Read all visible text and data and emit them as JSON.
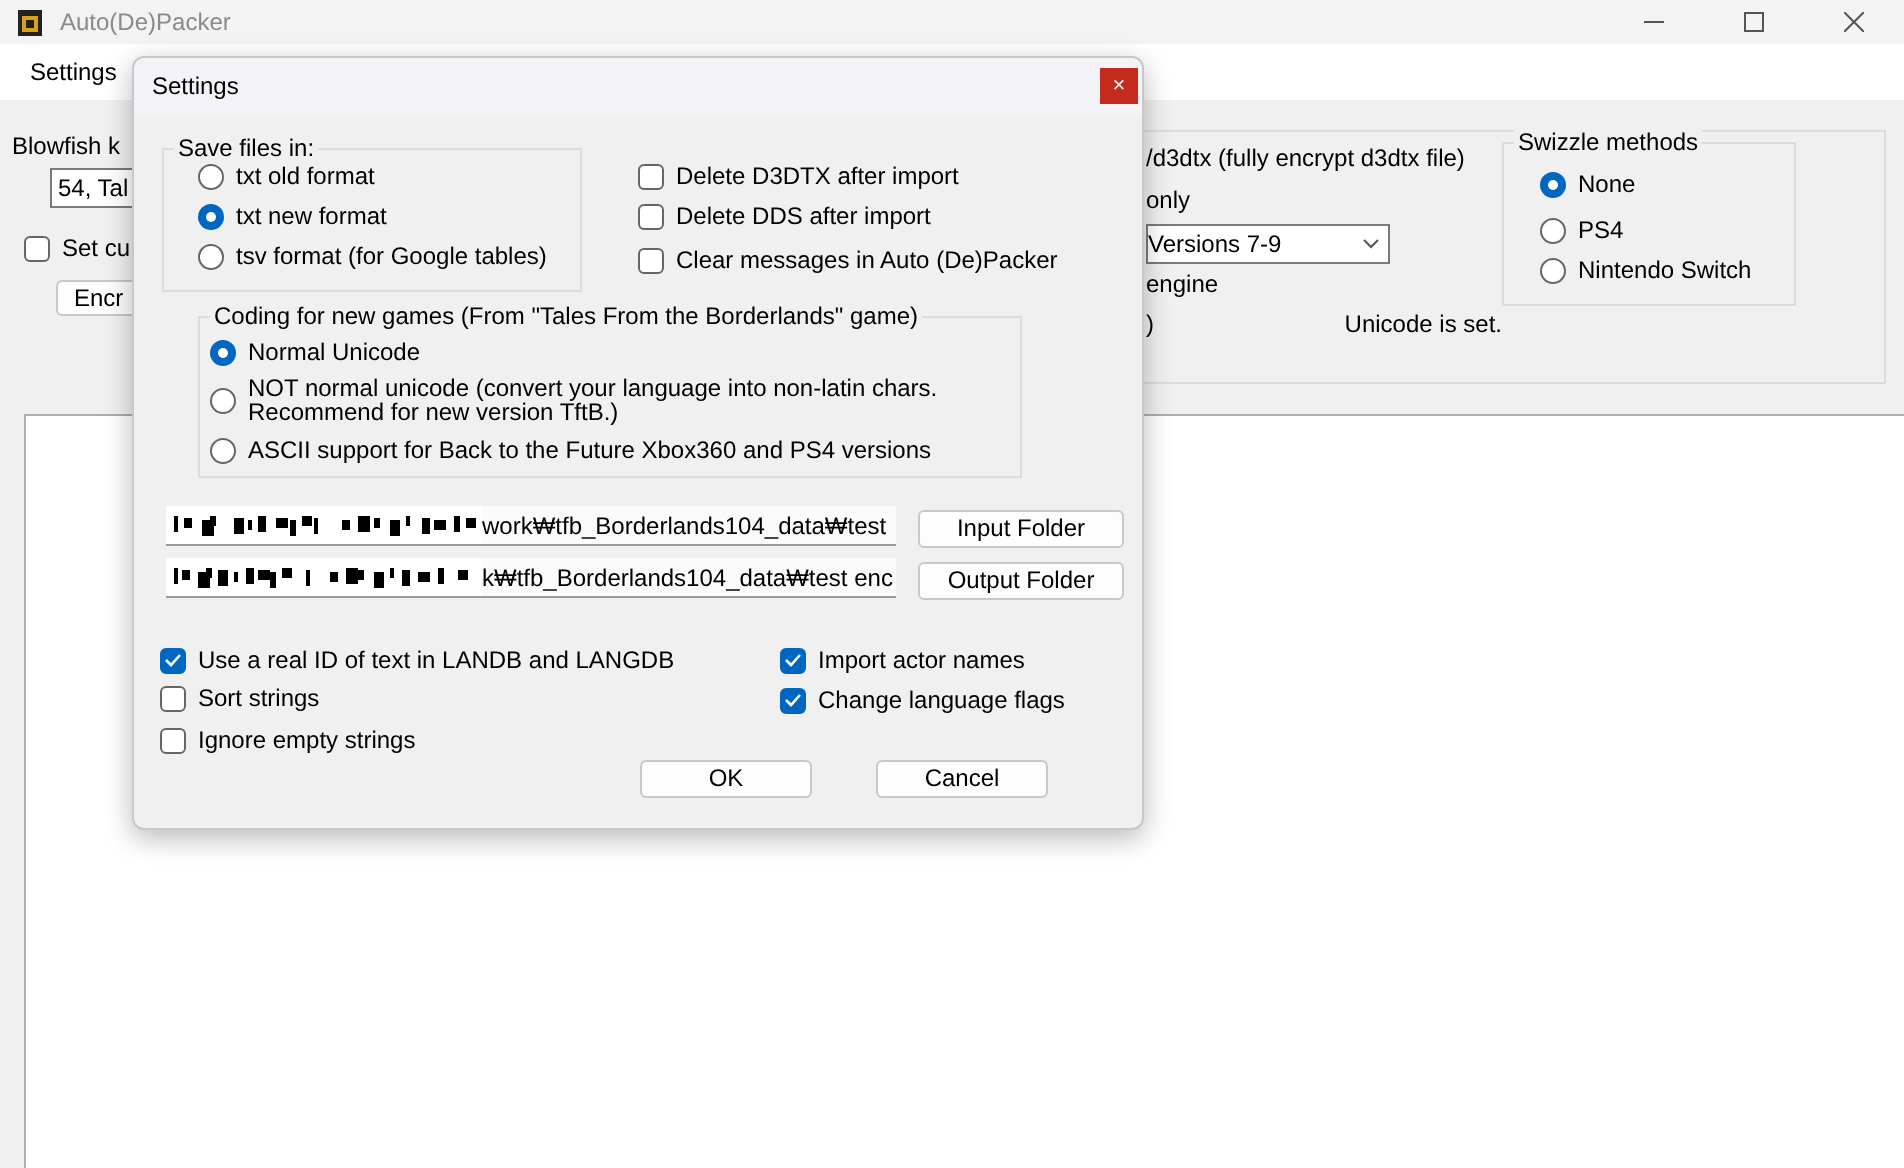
{
  "window": {
    "title": "Auto(De)Packer"
  },
  "menu": [
    {
      "label": "Settings"
    }
  ],
  "main": {
    "blowfish_label": "Blowfish k",
    "blowfish_value": "54, Tal",
    "custom_checkbox": {
      "label": "Set cu",
      "checked": false
    },
    "button": "Encr",
    "right_panel": {
      "line_1": "/d3dtx (fully encrypt d3dtx file)",
      "line_2": "only",
      "version_select": "Versions 7-9",
      "line_3": "engine",
      "line_4": ")",
      "status": "Unicode is set.",
      "swizzle": {
        "title": "Swizzle methods",
        "options": [
          {
            "label": "None",
            "selected": true
          },
          {
            "label": "PS4",
            "selected": false
          },
          {
            "label": "Nintendo Switch",
            "selected": false
          }
        ]
      }
    }
  },
  "dialog": {
    "title": "Settings",
    "close": "×",
    "save_files": {
      "title": "Save files in:",
      "options": [
        {
          "label": "txt old format",
          "selected": false
        },
        {
          "label": "txt new format",
          "selected": true
        },
        {
          "label": "tsv format (for Google tables)",
          "selected": false
        }
      ]
    },
    "top_checks": [
      {
        "label": "Delete D3DTX after import",
        "checked": false
      },
      {
        "label": "Delete DDS after import",
        "checked": false
      },
      {
        "label": "Clear messages in Auto (De)Packer",
        "checked": false
      }
    ],
    "coding": {
      "title": "Coding for new games (From \"Tales From the Borderlands\" game)",
      "options": [
        {
          "label": "Normal Unicode",
          "selected": true
        },
        {
          "label": "NOT normal unicode (convert your language into non-latin chars.\nRecommend for new version TftB.)",
          "selected": false
        },
        {
          "label": "ASCII support for Back to the Future Xbox360 and PS4 versions",
          "selected": false
        }
      ]
    },
    "folders": [
      {
        "value": "work₩tfb_Borderlands104_data₩test",
        "button": "Input Folder"
      },
      {
        "value": "k₩tfb_Borderlands104_data₩test enc",
        "button": "Output Folder"
      }
    ],
    "left_checks": [
      {
        "label": "Use a real ID of text in LANDB and LANGDB",
        "checked": true
      },
      {
        "label": "Sort strings",
        "checked": false
      },
      {
        "label": "Ignore empty strings",
        "checked": false
      }
    ],
    "right_checks": [
      {
        "label": "Import actor names",
        "checked": true
      },
      {
        "label": "Change language flags",
        "checked": true
      }
    ],
    "buttons": [
      "OK",
      "Cancel"
    ]
  }
}
